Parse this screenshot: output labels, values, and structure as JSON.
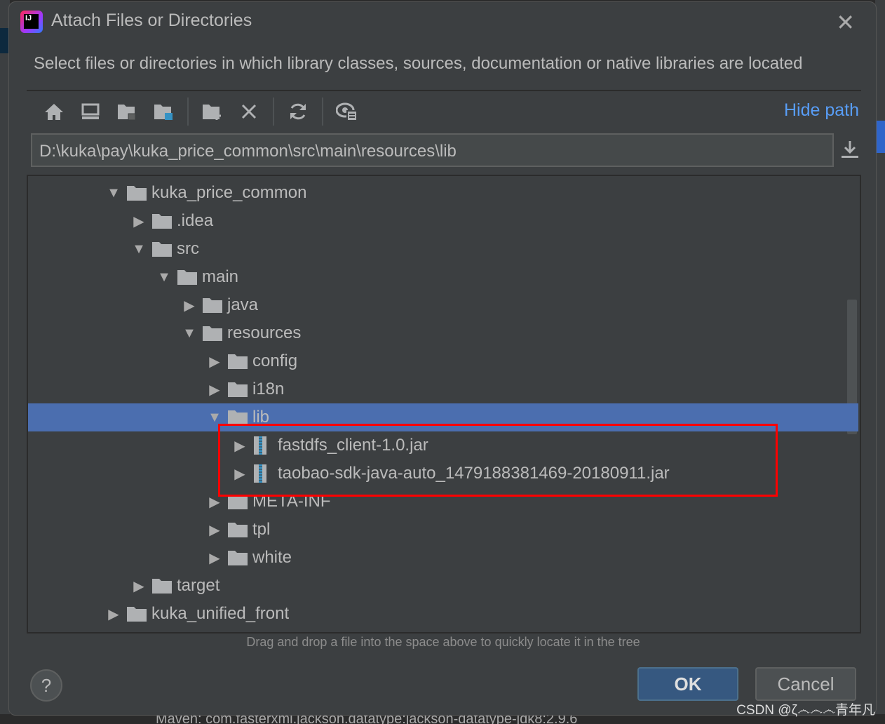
{
  "dialog": {
    "title": "Attach Files or Directories",
    "description": "Select files or directories in which library classes, sources, documentation or native libraries are located",
    "hide_path_label": "Hide path",
    "path_value": "D:\\kuka\\pay\\kuka_price_common\\src\\main\\resources\\lib",
    "toolbar": [
      "home-icon",
      "desktop-icon",
      "project-folder-icon",
      "module-folder-icon",
      "new-folder-icon",
      "delete-icon",
      "refresh-icon",
      "show-hidden-icon"
    ],
    "hint": "Drag and drop a file into the space above to quickly locate it in the tree",
    "ok_label": "OK",
    "cancel_label": "Cancel",
    "help_label": "?"
  },
  "tree": [
    {
      "label": "kuka_price_common",
      "level": 0,
      "type": "folder",
      "expanded": true
    },
    {
      "label": ".idea",
      "level": 1,
      "type": "folder",
      "expanded": false
    },
    {
      "label": "src",
      "level": 1,
      "type": "folder",
      "expanded": true
    },
    {
      "label": "main",
      "level": 2,
      "type": "folder",
      "expanded": true
    },
    {
      "label": "java",
      "level": 3,
      "type": "folder",
      "expanded": false
    },
    {
      "label": "resources",
      "level": 3,
      "type": "folder",
      "expanded": true
    },
    {
      "label": "config",
      "level": 4,
      "type": "folder",
      "expanded": false
    },
    {
      "label": "i18n",
      "level": 4,
      "type": "folder",
      "expanded": false
    },
    {
      "label": "lib",
      "level": 4,
      "type": "folder",
      "expanded": true,
      "selected": true
    },
    {
      "label": "fastdfs_client-1.0.jar",
      "level": 5,
      "type": "jar",
      "expanded": false
    },
    {
      "label": "taobao-sdk-java-auto_1479188381469-20180911.jar",
      "level": 5,
      "type": "jar",
      "expanded": false
    },
    {
      "label": "META-INF",
      "level": 4,
      "type": "folder",
      "expanded": false
    },
    {
      "label": "tpl",
      "level": 4,
      "type": "folder",
      "expanded": false
    },
    {
      "label": "white",
      "level": 4,
      "type": "folder",
      "expanded": false
    },
    {
      "label": "target",
      "level": 1,
      "type": "folder",
      "expanded": false
    },
    {
      "label": "kuka_unified_front",
      "level": 0,
      "type": "folder",
      "expanded": false
    }
  ],
  "background": {
    "bottom_text": "Maven: com.fasterxml.jackson.datatype:jackson-datatype-jdk8:2.9.6",
    "watermark": "CSDN @ζ෴෴෴青年凡"
  },
  "colors": {
    "selection": "#4b6eaf",
    "link": "#589df6",
    "highlight_box": "#ff0000",
    "ok_button": "#365880"
  }
}
